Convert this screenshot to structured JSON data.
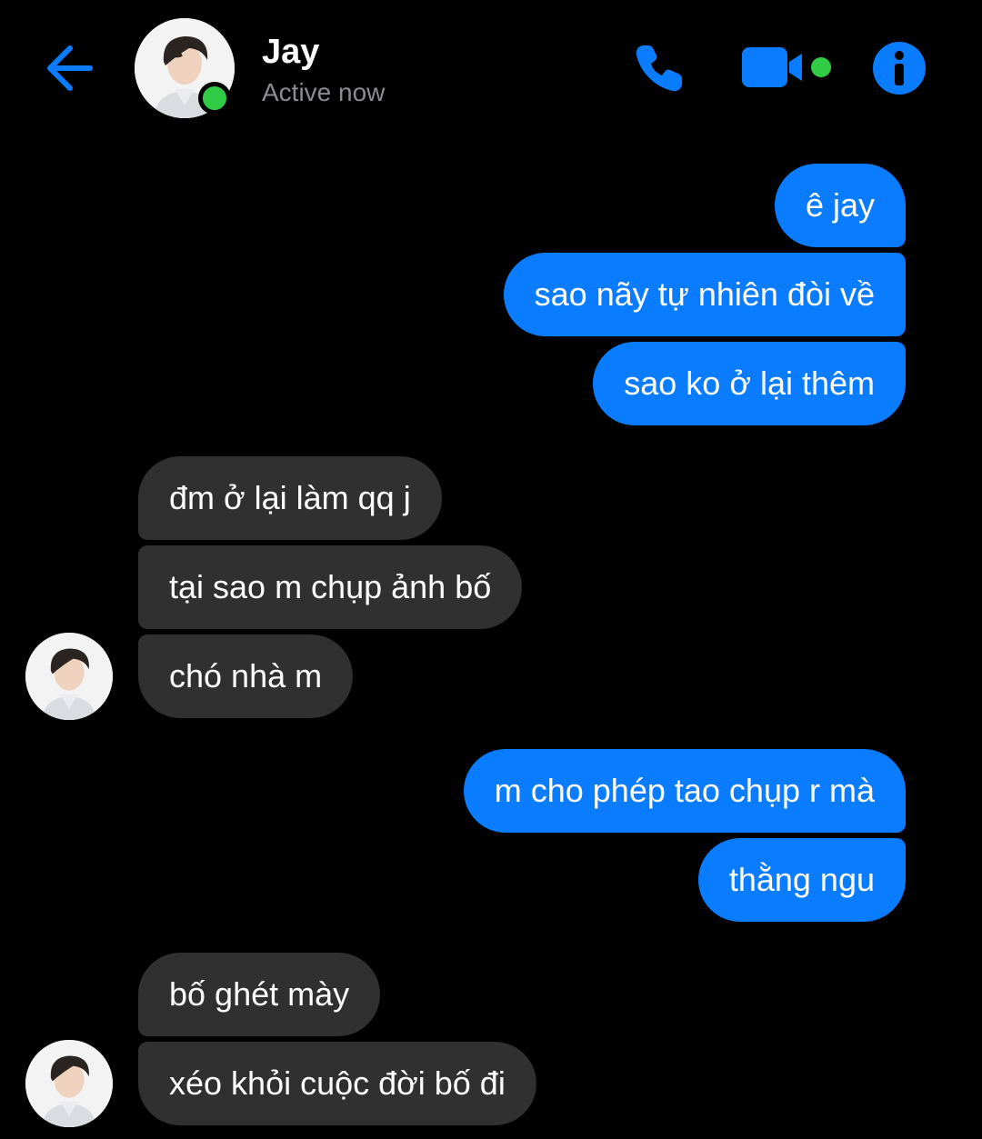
{
  "header": {
    "contact_name": "Jay",
    "status": "Active now",
    "online_color": "#31cc46",
    "icons": [
      "arrow-left-icon",
      "phone-icon",
      "video-camera-icon",
      "info-icon"
    ],
    "accent_color": "#0a7cff"
  },
  "messages": [
    {
      "sender": "me",
      "text": "ê jay"
    },
    {
      "sender": "me",
      "text": "sao nãy tự nhiên đòi về"
    },
    {
      "sender": "me",
      "text": "sao ko ở lại thêm"
    },
    {
      "sender": "Jay",
      "text": "đm ở lại làm qq j"
    },
    {
      "sender": "Jay",
      "text": "tại sao m chụp ảnh bố"
    },
    {
      "sender": "Jay",
      "text": "chó nhà m"
    },
    {
      "sender": "me",
      "text": "m cho phép tao chụp r mà"
    },
    {
      "sender": "me",
      "text": "thằng ngu"
    },
    {
      "sender": "Jay",
      "text": "bố ghét mày"
    },
    {
      "sender": "Jay",
      "text": "xéo khỏi cuộc đời bố đi"
    }
  ],
  "colors": {
    "outgoing_bubble": "#0a7cff",
    "incoming_bubble": "#303030",
    "background": "#000000"
  }
}
